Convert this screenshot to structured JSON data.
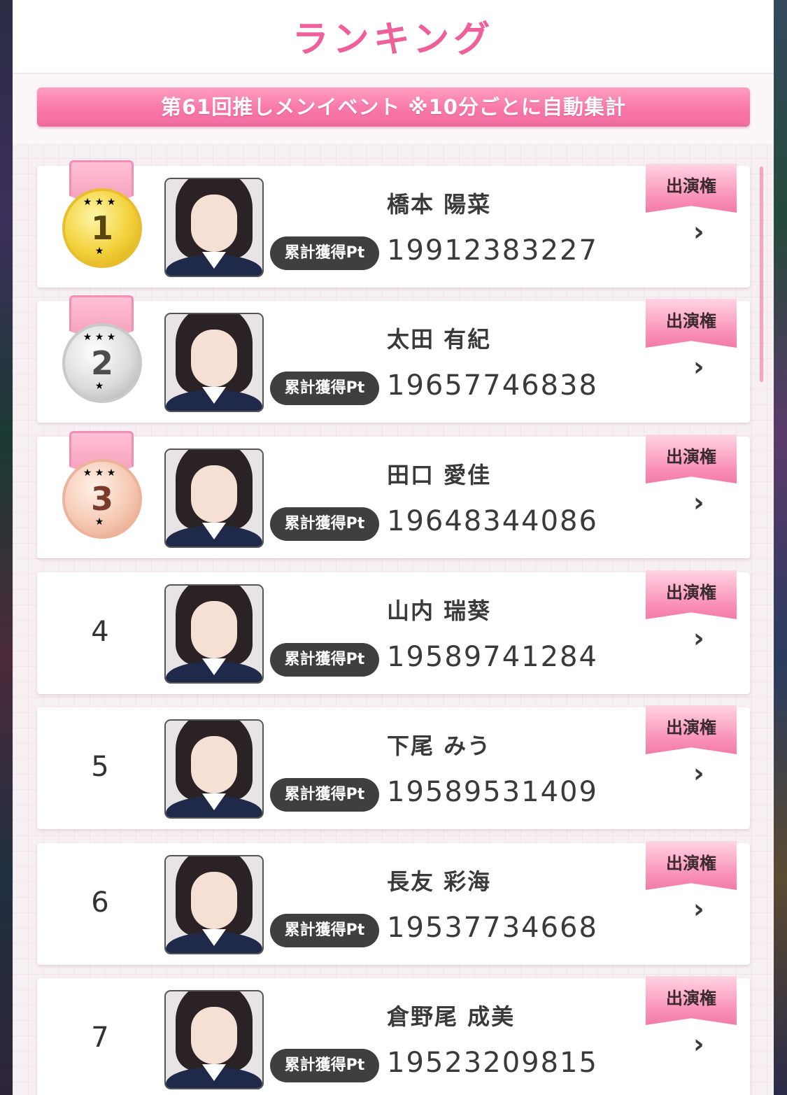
{
  "header": {
    "title": "ランキング"
  },
  "banner": {
    "text": "第61回推しメンイベント ※10分ごとに自動集計"
  },
  "labels": {
    "pt_badge": "累計獲得Pt",
    "performance_button": "出演権",
    "chevron": "›"
  },
  "rankings": [
    {
      "rank": "1",
      "medal": "gold",
      "name": "橋本 陽菜",
      "points": "19912383227"
    },
    {
      "rank": "2",
      "medal": "silver",
      "name": "太田 有紀",
      "points": "19657746838"
    },
    {
      "rank": "3",
      "medal": "bronze",
      "name": "田口 愛佳",
      "points": "19648344086"
    },
    {
      "rank": "4",
      "medal": "none",
      "name": "山内 瑞葵",
      "points": "19589741284"
    },
    {
      "rank": "5",
      "medal": "none",
      "name": "下尾 みう",
      "points": "19589531409"
    },
    {
      "rank": "6",
      "medal": "none",
      "name": "長友 彩海",
      "points": "19537734668"
    },
    {
      "rank": "7",
      "medal": "none",
      "name": "倉野尾 成美",
      "points": "19523209815"
    }
  ],
  "colors": {
    "accent": "#ef5f9a",
    "banner": "#f978a8",
    "badge": "#3f3f3f"
  },
  "icons": {
    "medal_stars": "★ ★ ★",
    "medal_bottom_star": "★"
  }
}
